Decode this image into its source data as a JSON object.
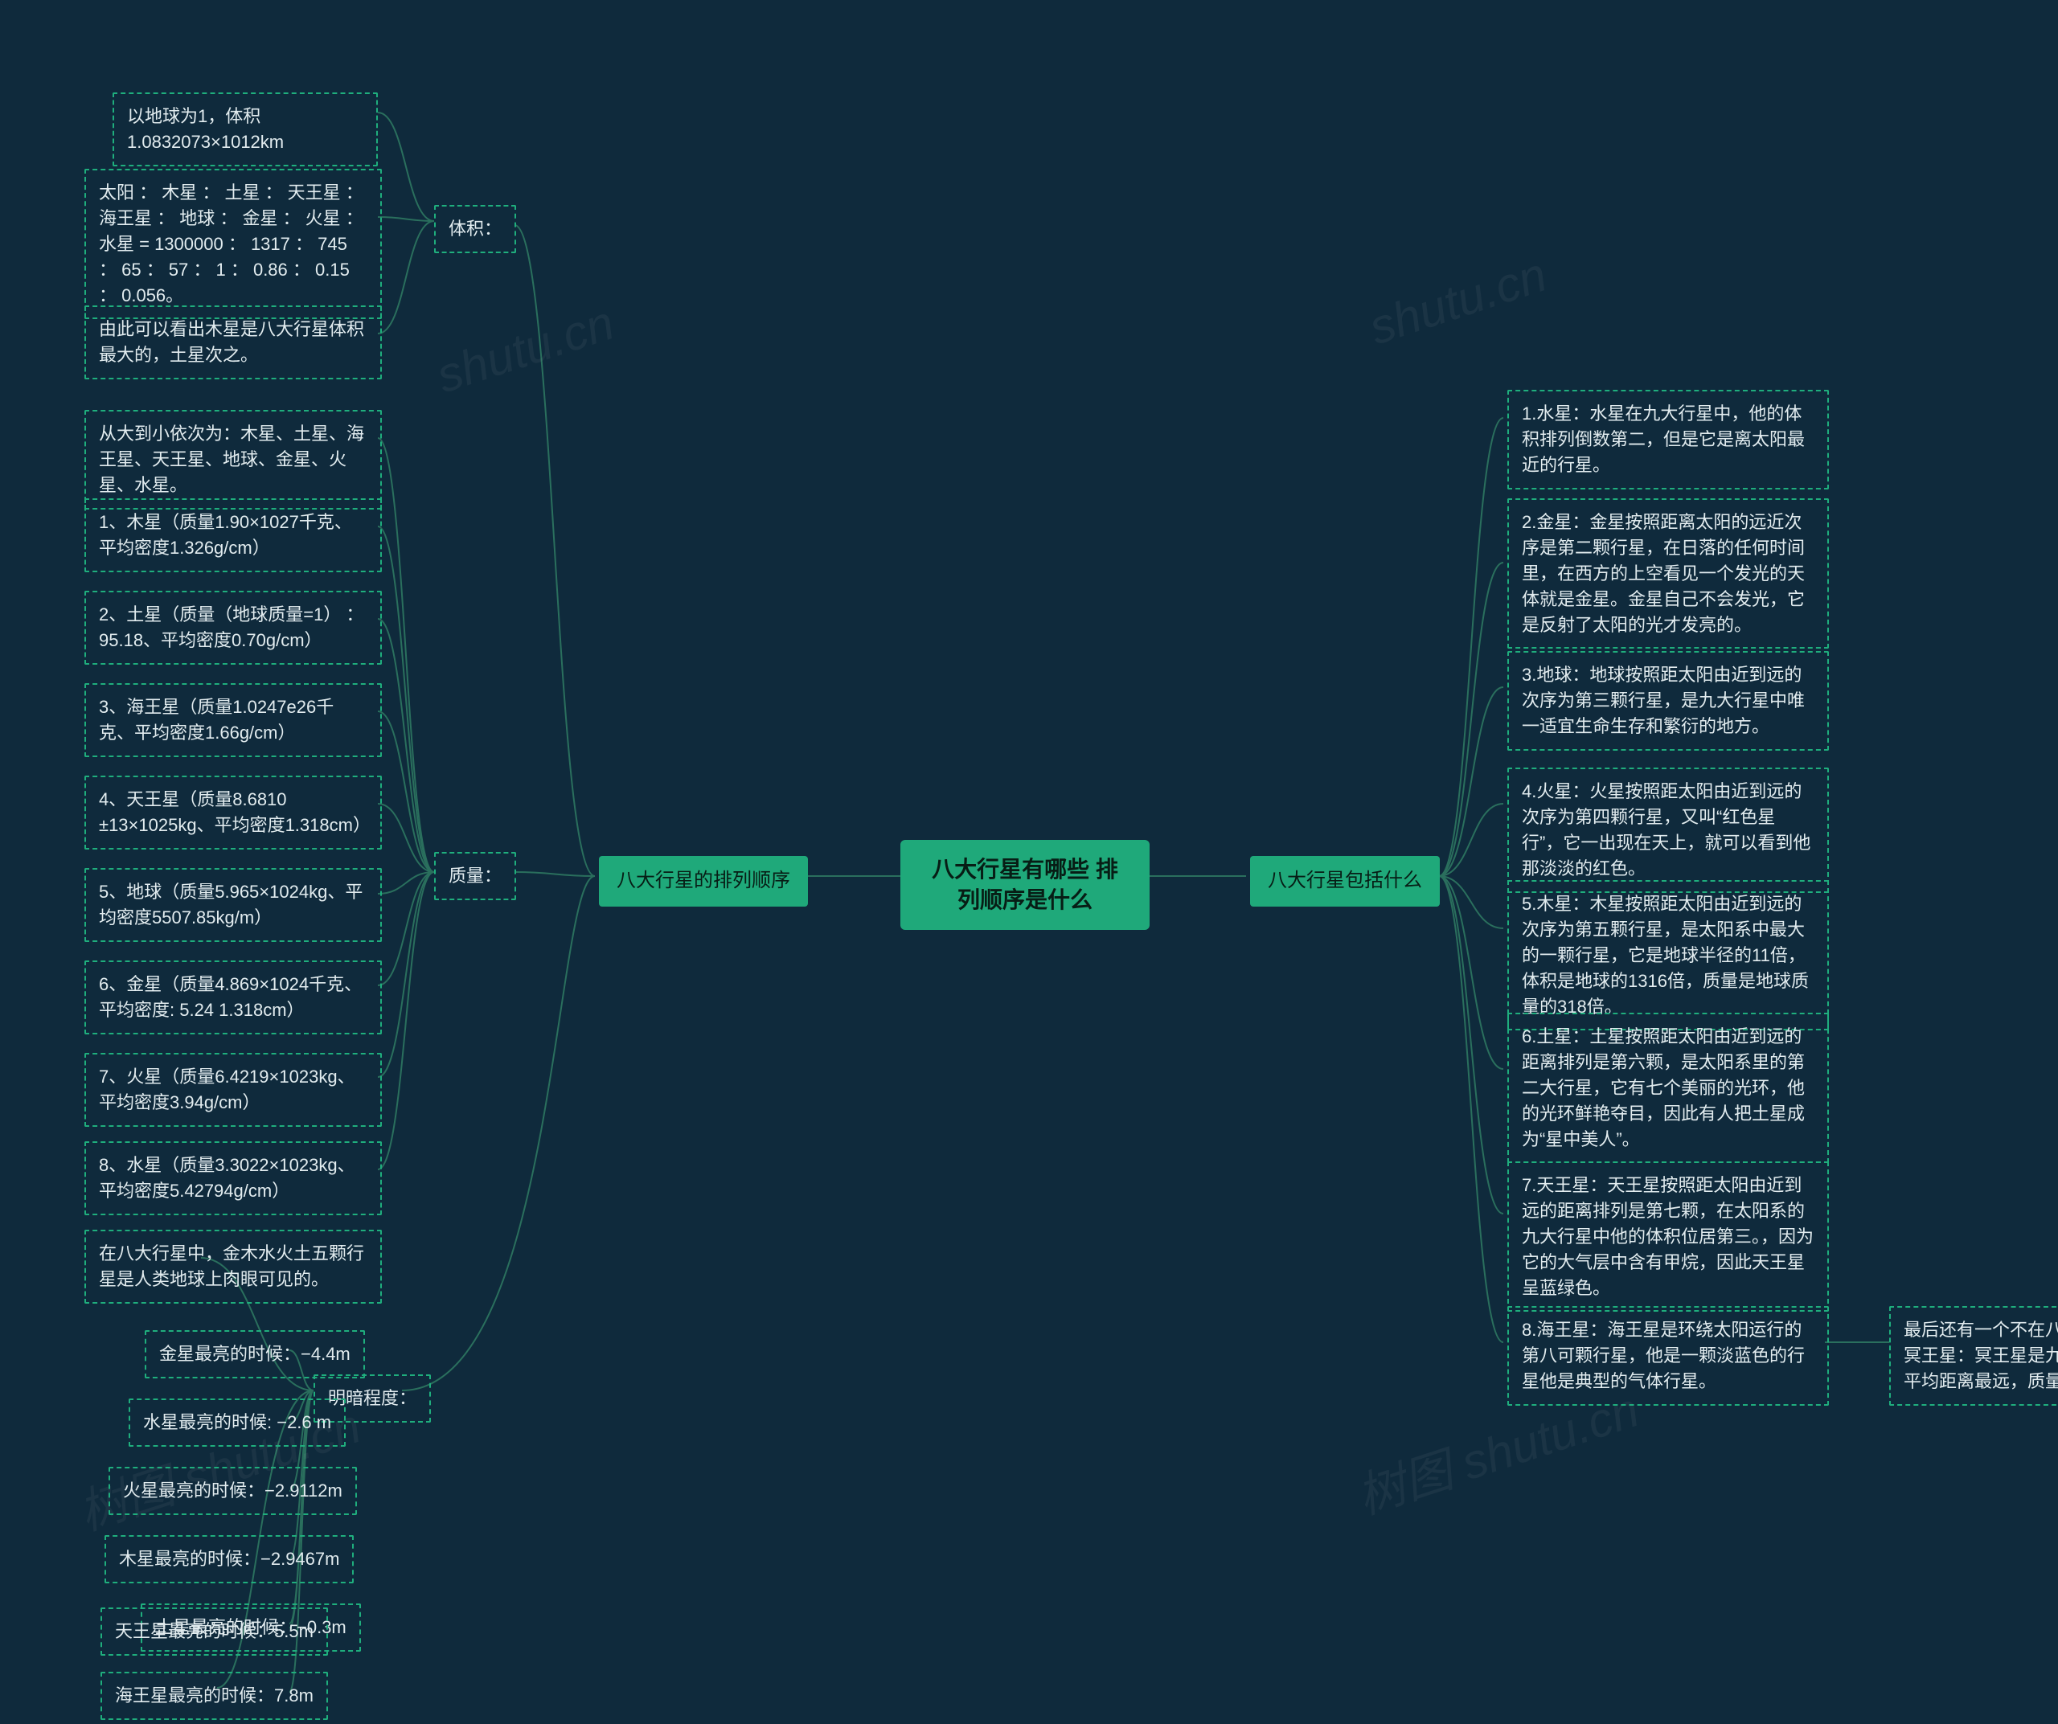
{
  "root": "八大行星有哪些 排列顺序是什么",
  "left": {
    "title": "八大行星的排列顺序",
    "volume": {
      "title": "体积：",
      "items": [
        "以地球为1，体积1.0832073×1012km",
        "太阳 ： 木星 ： 土星 ： 天王星 ： 海王星 ： 地球 ： 金星 ： 火星 ： 水星 = 1300000 ： 1317 ： 745 ： 65 ： 57 ： 1 ： 0.86 ： 0.15 ： 0.056。",
        "由此可以看出木星是八大行星体积最大的，土星次之。"
      ]
    },
    "mass": {
      "title": "质量：",
      "items": [
        "从大到小依次为：木星、土星、海王星、天王星、地球、金星、火星、水星。",
        "1、木星（质量1.90×1027千克、平均密度1.326g/cm）",
        "2、土星（质量（地球质量=1） ：95.18、平均密度0.70g/cm）",
        "3、海王星（质量1.0247e26千克、平均密度1.66g/cm）",
        "4、天王星（质量8.6810 ±13×1025kg、平均密度1.318cm）",
        "5、地球（质量5.965×1024kg、平均密度5507.85kg/m）",
        "6、金星（质量4.869×1024千克、平均密度: 5.24 1.318cm）",
        "7、火星（质量6.4219×1023kg、平均密度3.94g/cm）",
        "8、水星（质量3.3022×1023kg、平均密度5.42794g/cm）"
      ]
    },
    "brightness": {
      "title": "明暗程度：",
      "items": [
        "在八大行星中，金木水火土五颗行星是人类地球上肉眼可见的。",
        "金星最亮的时候：−4.4m",
        "水星最亮的时候: −2.6 m",
        "火星最亮的时候：−2.9112m",
        "木星最亮的时候：−2.9467m",
        "土星最亮的时候：−0.3m",
        "天王星最亮的时候：5.5m",
        "海王星最亮的时候：7.8m"
      ]
    }
  },
  "right": {
    "title": "八大行星包括什么",
    "items": [
      "1.水星：水星在九大行星中，他的体积排列倒数第二，但是它是离太阳最近的行星。",
      "2.金星：金星按照距离太阳的远近次序是第二颗行星，在日落的任何时间里，在西方的上空看见一个发光的天体就是金星。金星自己不会发光，它是反射了太阳的光才发亮的。",
      "3.地球：地球按照距太阳由近到远的次序为第三颗行星，是九大行星中唯一适宜生命生存和繁衍的地方。",
      "4.火星：火星按照距太阳由近到远的次序为第四颗行星，又叫“红色星行”，它一出现在天上，就可以看到他那淡淡的红色。",
      "5.木星：木星按照距太阳由近到远的次序为第五颗行星，是太阳系中最大的一颗行星，它是地球半径的11倍，体积是地球的1316倍，质量是地球质量的318倍。",
      "6.土星：土星按照距太阳由近到远的距离排列是第六颗，是太阳系里的第二大行星，它有七个美丽的光环，他的光环鲜艳夺目，因此有人把土星成为“星中美人”。",
      "7.天王星：天王星按照距太阳由近到远的距离排列是第七颗，在太阳系的九大行星中他的体积位居第三。，因为它的大气层中含有甲烷，因此天王星呈蓝绿色。",
      "8.海王星：海王星是环绕太阳运行的第八可颗行星，他是一颗淡蓝色的行星他是典型的气体行星。"
    ],
    "extra": "最后还有一个不在八大行星之列的：冥王星：冥王星是九大行星中离太阳平均距离最远，质量最小的行星。"
  },
  "watermarks": [
    "shutu.cn",
    "树图 shutu.cn",
    "shutu.cn",
    "树图 shutu.cn"
  ]
}
